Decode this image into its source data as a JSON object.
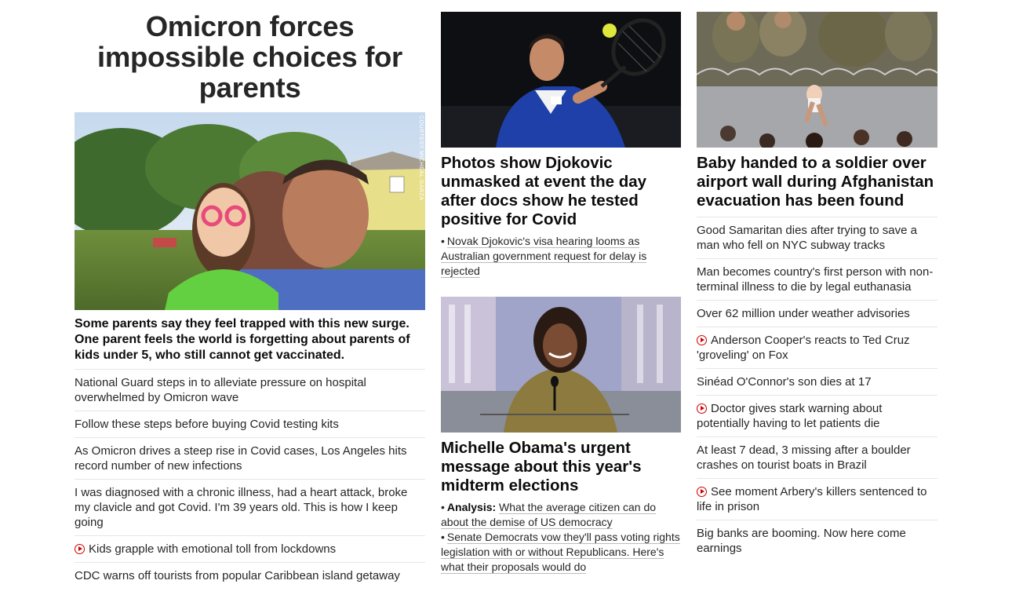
{
  "left": {
    "hero_title": "Omicron forces impossible choices for parents",
    "photo_credit": "COURTESY MICHEAL GARZA",
    "hero_subtitle": "Some parents say they feel trapped with this new surge. One parent feels the world is forgetting about parents of kids under 5, who still cannot get vaccinated.",
    "items": [
      {
        "text": "National Guard steps in to alleviate pressure on hospital overwhelmed by Omicron wave",
        "video": false
      },
      {
        "text": "Follow these steps before buying Covid testing kits",
        "video": false
      },
      {
        "text": "As Omicron drives a steep rise in Covid cases, Los Angeles hits record number of new infections",
        "video": false
      },
      {
        "text": "I was diagnosed with a chronic illness, had a heart attack, broke my clavicle and got Covid. I'm 39 years old. This is how I keep going",
        "video": false
      },
      {
        "text": "Kids grapple with emotional toll from lockdowns",
        "video": true
      },
      {
        "text": "CDC warns off tourists from popular Caribbean island getaway",
        "video": false
      }
    ]
  },
  "middle": {
    "story1": {
      "headline": "Photos show Djokovic unmasked at event the day after docs show he tested positive for Covid",
      "related": "Novak Djokovic's visa hearing looms as Australian government request for delay is rejected"
    },
    "story2": {
      "headline": "Michelle Obama's urgent message about this year's midterm elections",
      "related1_prefix": "Analysis:",
      "related1": "What the average citizen can do about the demise of US democracy",
      "related2": "Senate Democrats vow they'll pass voting rights legislation with or without Republicans. Here's what their proposals would do"
    },
    "bullet": "•"
  },
  "right": {
    "headline": "Baby handed to a soldier over airport wall during Afghanistan evacuation has been found",
    "items": [
      {
        "text": "Good Samaritan dies after trying to save a man who fell on NYC subway tracks",
        "video": false
      },
      {
        "text": "Man becomes country's first person with non-terminal illness to die by legal euthanasia",
        "video": false
      },
      {
        "text": "Over 62 million under weather advisories",
        "video": false
      },
      {
        "text": "Anderson Cooper's reacts to Ted Cruz 'groveling' on Fox",
        "video": true
      },
      {
        "text": "Sinéad O'Connor's son dies at 17",
        "video": false
      },
      {
        "text": "Doctor gives stark warning about potentially having to let patients die",
        "video": true
      },
      {
        "text": "At least 7 dead, 3 missing after a boulder crashes on tourist boats in Brazil",
        "video": false
      },
      {
        "text": "See moment Arbery's killers sentenced to life in prison",
        "video": true
      },
      {
        "text": "Big banks are booming. Now here come earnings",
        "video": false
      }
    ]
  },
  "colors": {
    "video_icon": "#cc0000",
    "divider": "#e6e6e6",
    "text": "#262626"
  }
}
